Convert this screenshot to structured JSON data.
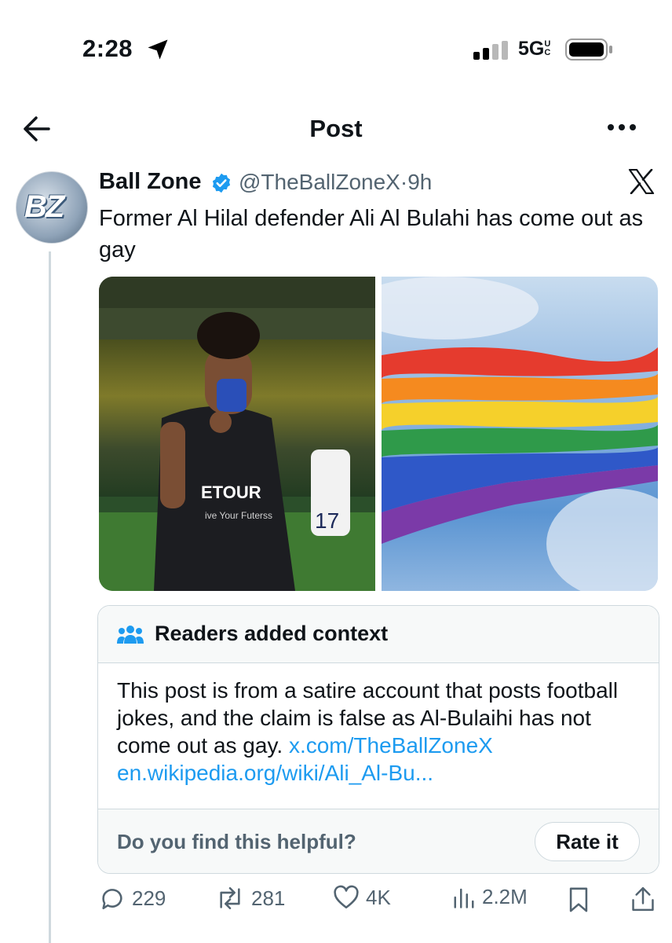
{
  "status_bar": {
    "time": "2:28",
    "network": "5G",
    "network_suffix": "UC",
    "icons": [
      "location-arrow-icon",
      "signal-bars-icon",
      "battery-icon"
    ]
  },
  "nav": {
    "title": "Post",
    "icons": [
      "back-arrow-icon",
      "more-icon"
    ]
  },
  "post": {
    "author_name": "Ball Zone",
    "handle": "@TheBallZoneX",
    "separator": "·",
    "time_ago": "9h",
    "avatar_text": "BZ",
    "text": "Former Al Hilal defender Ali Al Bulahi has come out as gay",
    "media": [
      "football-player-photo",
      "rainbow-flag-photo"
    ]
  },
  "context_card": {
    "title": "Readers added context",
    "body": "This post is from a satire account that posts football jokes, and the claim is false as Al-Bulaihi has not come out as gay. ",
    "link1": "x.com/TheBallZoneX",
    "link2": "en.wikipedia.org/wiki/Ali_Al-Bu...",
    "helpful_prompt": "Do you find this helpful?",
    "rate_button": "Rate it"
  },
  "actions": {
    "replies": "229",
    "reposts": "281",
    "likes": "4K",
    "views": "2.2M"
  },
  "colors": {
    "text": "#0f1419",
    "secondary": "#536471",
    "link": "#1d9bf0",
    "verified": "#1d9bf0",
    "border": "#cfd9de"
  }
}
